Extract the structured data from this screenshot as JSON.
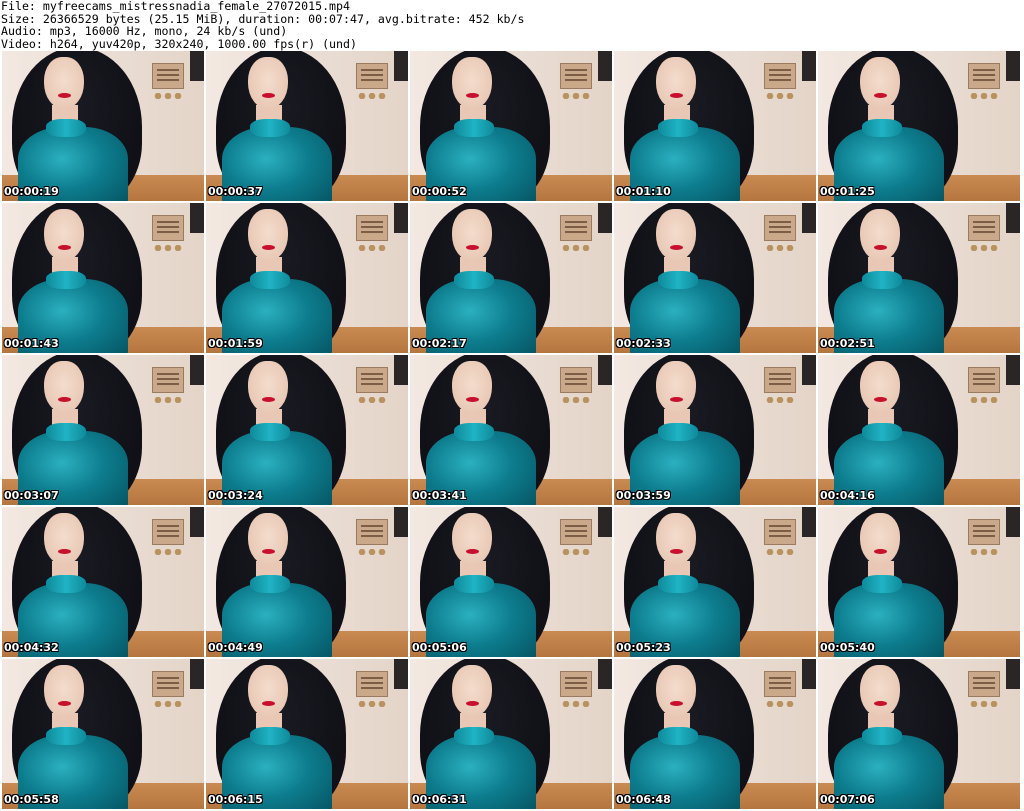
{
  "header": {
    "file": "File: myfreecams_mistressnadia_female_27072015.mp4",
    "size": "Size: 26366529 bytes (25.15 MiB), duration: 00:07:47, avg.bitrate: 452 kb/s",
    "audio": "Audio: mp3, 16000 Hz, mono, 24 kb/s (und)",
    "video": "Video: h264, yuv420p, 320x240, 1000.00 fps(r) (und)"
  },
  "thumbnails": [
    {
      "timestamp": "00:00:19"
    },
    {
      "timestamp": "00:00:37"
    },
    {
      "timestamp": "00:00:52"
    },
    {
      "timestamp": "00:01:10"
    },
    {
      "timestamp": "00:01:25"
    },
    {
      "timestamp": "00:01:43"
    },
    {
      "timestamp": "00:01:59"
    },
    {
      "timestamp": "00:02:17"
    },
    {
      "timestamp": "00:02:33"
    },
    {
      "timestamp": "00:02:51"
    },
    {
      "timestamp": "00:03:07"
    },
    {
      "timestamp": "00:03:24"
    },
    {
      "timestamp": "00:03:41"
    },
    {
      "timestamp": "00:03:59"
    },
    {
      "timestamp": "00:04:16"
    },
    {
      "timestamp": "00:04:32"
    },
    {
      "timestamp": "00:04:49"
    },
    {
      "timestamp": "00:05:06"
    },
    {
      "timestamp": "00:05:23"
    },
    {
      "timestamp": "00:05:40"
    },
    {
      "timestamp": "00:05:58"
    },
    {
      "timestamp": "00:06:15"
    },
    {
      "timestamp": "00:06:31"
    },
    {
      "timestamp": "00:06:48"
    },
    {
      "timestamp": "00:07:06"
    }
  ]
}
